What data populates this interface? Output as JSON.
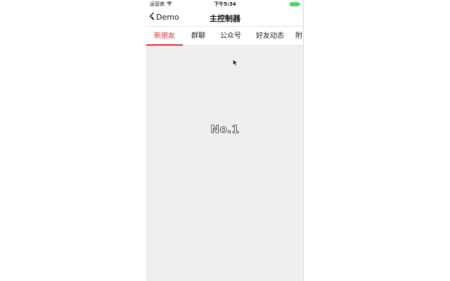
{
  "statusbar": {
    "carrier": "运营商",
    "time": "下午5:34",
    "icons": [
      "wifi-icon",
      "battery-icon"
    ],
    "battery_color": "#4cd964"
  },
  "navbar": {
    "back_label": "Demo",
    "title": "主控制器"
  },
  "tabs": [
    {
      "label": "新朋友",
      "active": true
    },
    {
      "label": "群聊",
      "active": false
    },
    {
      "label": "公众号",
      "active": false
    },
    {
      "label": "好友动态",
      "active": false
    },
    {
      "label": "附",
      "active": false
    }
  ],
  "content": {
    "label": "No.1"
  },
  "colors": {
    "accent": "#e0312f",
    "content_bg": "#efefef"
  }
}
